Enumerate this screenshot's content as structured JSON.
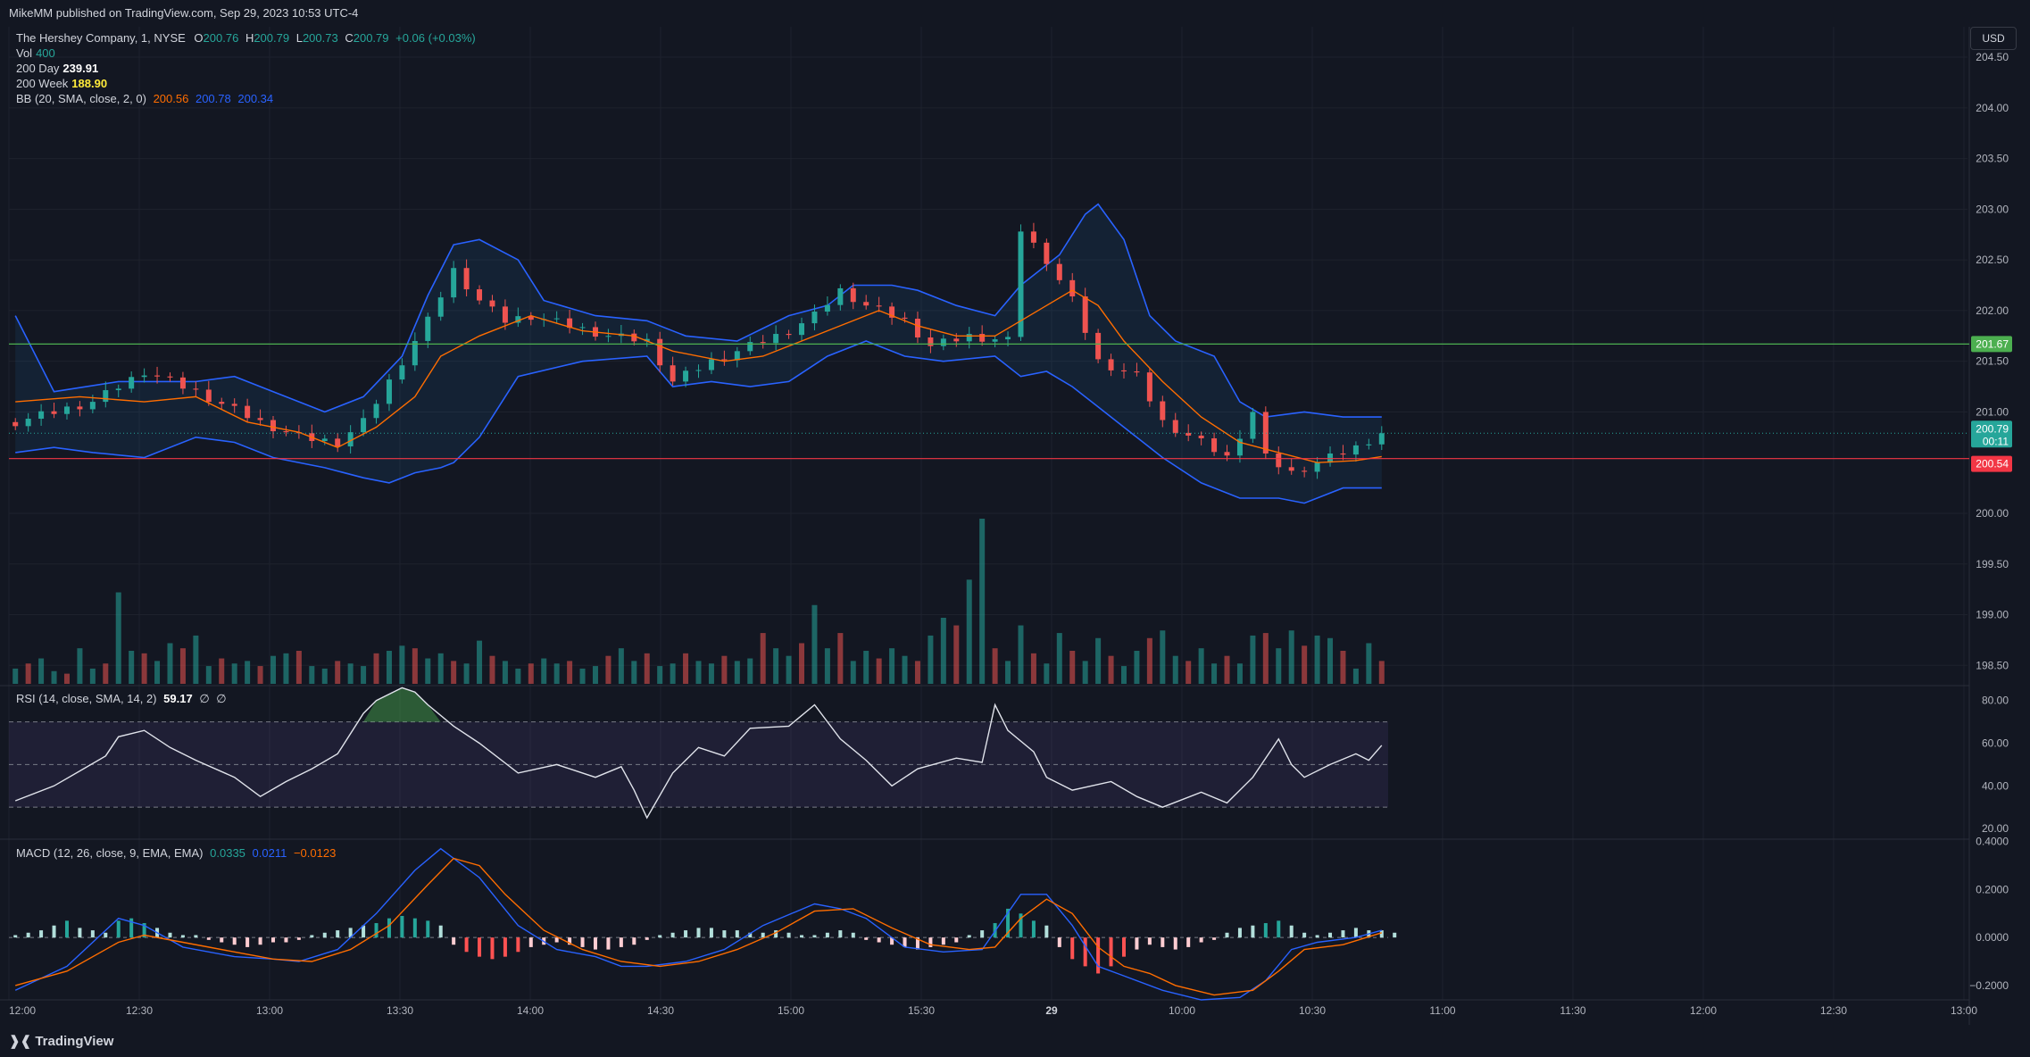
{
  "header": {
    "published": "MikeMM published on TradingView.com, Sep 29, 2023 10:53 UTC-4"
  },
  "legend": {
    "symbol": "The Hershey Company, 1, NYSE",
    "o_label": "O",
    "o_value": "200.76",
    "h_label": "H",
    "h_value": "200.79",
    "l_label": "L",
    "l_value": "200.73",
    "c_label": "C",
    "c_value": "200.79",
    "change": "+0.06 (+0.03%)",
    "vol_label": "Vol",
    "vol_value": "400",
    "ma200d_label": "200 Day",
    "ma200d_value": "239.91",
    "ma200w_label": "200 Week",
    "ma200w_value": "188.90",
    "bb_label": "BB (20, SMA, close, 2, 0)",
    "bb_basis": "200.56",
    "bb_upper": "200.78",
    "bb_lower": "200.34",
    "rsi_label": "RSI (14, close, SMA, 14, 2)",
    "rsi_value": "59.17",
    "rsi_extra1": "∅",
    "rsi_extra2": "∅",
    "macd_label": "MACD (12, 26, close, 9, EMA, EMA)",
    "macd_value": "0.0335",
    "macd_signal": "0.0211",
    "macd_hist": "−0.0123"
  },
  "currency": "USD",
  "footer": {
    "logo": "TradingView",
    "logo_icon": "tradingview-logo-icon"
  },
  "colors": {
    "up": "#26a69a",
    "down": "#ef5350",
    "bb": "#2962ff",
    "basis": "#ff6d00",
    "green_line": "#4caf50",
    "red_line": "#f23645"
  },
  "chart_data": {
    "type": "candlestick",
    "symbol": "HSY",
    "price_axis": {
      "ticks": [
        "204.50",
        "204.00",
        "203.50",
        "203.00",
        "202.50",
        "202.00",
        "201.50",
        "201.00",
        "200.00",
        "199.50",
        "199.00",
        "198.50"
      ],
      "range": [
        198.3,
        204.8
      ]
    },
    "price_labels": {
      "green_line": "201.67",
      "current_price": "200.79",
      "countdown": "00:11",
      "red_line": "200.54"
    },
    "horizontal_lines": {
      "green": 201.67,
      "red": 200.54
    },
    "time_axis": [
      "12:00",
      "12:30",
      "13:00",
      "13:30",
      "14:00",
      "14:30",
      "15:00",
      "15:30",
      "29",
      "10:00",
      "10:30",
      "11:00",
      "11:30",
      "12:00",
      "12:30",
      "13:00"
    ],
    "close_path": [
      [
        0,
        200.9
      ],
      [
        6,
        201.1
      ],
      [
        10,
        201.4
      ],
      [
        14,
        201.2
      ],
      [
        19,
        200.9
      ],
      [
        22,
        200.75
      ],
      [
        25,
        200.7
      ],
      [
        27,
        200.9
      ],
      [
        30,
        201.5
      ],
      [
        32,
        201.9
      ],
      [
        34,
        202.4
      ],
      [
        36,
        202.1
      ],
      [
        38,
        201.9
      ],
      [
        40,
        201.95
      ],
      [
        43,
        201.85
      ],
      [
        46,
        201.75
      ],
      [
        49,
        201.7
      ],
      [
        51,
        201.3
      ],
      [
        54,
        201.5
      ],
      [
        57,
        201.65
      ],
      [
        60,
        201.8
      ],
      [
        62,
        201.95
      ],
      [
        64,
        202.2
      ],
      [
        66,
        202.05
      ],
      [
        69,
        201.9
      ],
      [
        71,
        201.65
      ],
      [
        74,
        201.75
      ],
      [
        77,
        201.7
      ],
      [
        78,
        202.8
      ],
      [
        80,
        202.5
      ],
      [
        82,
        202.1
      ],
      [
        84,
        201.5
      ],
      [
        87,
        201.35
      ],
      [
        89,
        200.9
      ],
      [
        92,
        200.7
      ],
      [
        94,
        200.55
      ],
      [
        96,
        201.0
      ],
      [
        97,
        200.55
      ],
      [
        99,
        200.4
      ],
      [
        102,
        200.55
      ],
      [
        104,
        200.65
      ],
      [
        106,
        200.79
      ]
    ],
    "bb_upper_path": [
      [
        0,
        201.95
      ],
      [
        3,
        201.2
      ],
      [
        8,
        201.3
      ],
      [
        14,
        201.3
      ],
      [
        17,
        201.35
      ],
      [
        20,
        201.2
      ],
      [
        24,
        201.0
      ],
      [
        27,
        201.15
      ],
      [
        30,
        201.55
      ],
      [
        32,
        202.15
      ],
      [
        34,
        202.65
      ],
      [
        36,
        202.7
      ],
      [
        39,
        202.5
      ],
      [
        41,
        202.1
      ],
      [
        45,
        201.95
      ],
      [
        49,
        201.9
      ],
      [
        52,
        201.75
      ],
      [
        56,
        201.7
      ],
      [
        60,
        201.95
      ],
      [
        63,
        202.05
      ],
      [
        65,
        202.25
      ],
      [
        68,
        202.25
      ],
      [
        70,
        202.2
      ],
      [
        73,
        202.05
      ],
      [
        76,
        201.95
      ],
      [
        78,
        202.25
      ],
      [
        81,
        202.55
      ],
      [
        83,
        202.95
      ],
      [
        84,
        203.05
      ],
      [
        86,
        202.7
      ],
      [
        88,
        201.95
      ],
      [
        90,
        201.7
      ],
      [
        93,
        201.55
      ],
      [
        95,
        201.1
      ],
      [
        97,
        200.95
      ],
      [
        100,
        201.0
      ],
      [
        103,
        200.95
      ],
      [
        106,
        200.95
      ]
    ],
    "bb_lower_path": [
      [
        0,
        200.6
      ],
      [
        3,
        200.65
      ],
      [
        6,
        200.6
      ],
      [
        10,
        200.55
      ],
      [
        14,
        200.75
      ],
      [
        17,
        200.7
      ],
      [
        20,
        200.55
      ],
      [
        24,
        200.45
      ],
      [
        27,
        200.35
      ],
      [
        29,
        200.3
      ],
      [
        31,
        200.4
      ],
      [
        33,
        200.45
      ],
      [
        34,
        200.5
      ],
      [
        36,
        200.75
      ],
      [
        39,
        201.35
      ],
      [
        44,
        201.5
      ],
      [
        49,
        201.55
      ],
      [
        51,
        201.25
      ],
      [
        54,
        201.3
      ],
      [
        57,
        201.25
      ],
      [
        60,
        201.3
      ],
      [
        63,
        201.55
      ],
      [
        66,
        201.7
      ],
      [
        69,
        201.55
      ],
      [
        72,
        201.5
      ],
      [
        76,
        201.55
      ],
      [
        78,
        201.35
      ],
      [
        80,
        201.4
      ],
      [
        82,
        201.25
      ],
      [
        84,
        201.05
      ],
      [
        86,
        200.85
      ],
      [
        89,
        200.55
      ],
      [
        92,
        200.3
      ],
      [
        95,
        200.15
      ],
      [
        98,
        200.15
      ],
      [
        100,
        200.1
      ],
      [
        103,
        200.25
      ],
      [
        106,
        200.25
      ]
    ],
    "bb_basis_path": [
      [
        0,
        201.1
      ],
      [
        5,
        201.15
      ],
      [
        10,
        201.1
      ],
      [
        14,
        201.15
      ],
      [
        18,
        200.9
      ],
      [
        22,
        200.8
      ],
      [
        25,
        200.65
      ],
      [
        28,
        200.85
      ],
      [
        31,
        201.15
      ],
      [
        33,
        201.55
      ],
      [
        36,
        201.75
      ],
      [
        40,
        201.95
      ],
      [
        44,
        201.8
      ],
      [
        48,
        201.75
      ],
      [
        51,
        201.6
      ],
      [
        55,
        201.5
      ],
      [
        58,
        201.55
      ],
      [
        61,
        201.7
      ],
      [
        64,
        201.85
      ],
      [
        67,
        202.0
      ],
      [
        70,
        201.85
      ],
      [
        73,
        201.75
      ],
      [
        76,
        201.75
      ],
      [
        78,
        201.9
      ],
      [
        80,
        202.05
      ],
      [
        82,
        202.2
      ],
      [
        84,
        202.05
      ],
      [
        86,
        201.7
      ],
      [
        89,
        201.3
      ],
      [
        92,
        200.95
      ],
      [
        95,
        200.7
      ],
      [
        98,
        200.6
      ],
      [
        101,
        200.5
      ],
      [
        104,
        200.52
      ],
      [
        106,
        200.56
      ]
    ],
    "volume": [
      6,
      8,
      10,
      5,
      4,
      14,
      6,
      8,
      36,
      13,
      12,
      9,
      16,
      14,
      19,
      7,
      10,
      8,
      9,
      7,
      11,
      12,
      13,
      7,
      6,
      9,
      8,
      7,
      12,
      13,
      15,
      14,
      10,
      12,
      9,
      8,
      17,
      11,
      9,
      6,
      8,
      10,
      8,
      9,
      6,
      7,
      11,
      14,
      9,
      12,
      7,
      8,
      12,
      9,
      8,
      11,
      9,
      10,
      20,
      14,
      11,
      16,
      31,
      14,
      20,
      9,
      13,
      10,
      14,
      11,
      9,
      19,
      26,
      23,
      41,
      65,
      14,
      9,
      23,
      12,
      8,
      20,
      13,
      9,
      18,
      11,
      7,
      13,
      18,
      21,
      11,
      9,
      14,
      8,
      11,
      8,
      19,
      20,
      14,
      21,
      15,
      19,
      18,
      13,
      6,
      16,
      9
    ],
    "rsi": {
      "ticks": [
        "80.00",
        "60.00",
        "40.00",
        "20.00"
      ],
      "bands": [
        70,
        50,
        30
      ],
      "range": [
        15,
        87
      ],
      "value": 59.17,
      "path": [
        [
          0,
          33
        ],
        [
          3,
          40
        ],
        [
          5,
          47
        ],
        [
          7,
          54
        ],
        [
          8,
          63
        ],
        [
          10,
          66
        ],
        [
          12,
          58
        ],
        [
          14,
          52
        ],
        [
          17,
          44
        ],
        [
          19,
          35
        ],
        [
          21,
          42
        ],
        [
          23,
          48
        ],
        [
          25,
          55
        ],
        [
          27,
          74
        ],
        [
          28,
          80
        ],
        [
          30,
          86
        ],
        [
          31,
          84
        ],
        [
          32,
          78
        ],
        [
          34,
          68
        ],
        [
          36,
          60
        ],
        [
          39,
          46
        ],
        [
          42,
          50
        ],
        [
          45,
          44
        ],
        [
          47,
          49
        ],
        [
          48,
          38
        ],
        [
          49,
          25
        ],
        [
          51,
          46
        ],
        [
          53,
          58
        ],
        [
          55,
          54
        ],
        [
          57,
          67
        ],
        [
          60,
          68
        ],
        [
          62,
          78
        ],
        [
          64,
          62
        ],
        [
          66,
          52
        ],
        [
          68,
          40
        ],
        [
          70,
          48
        ],
        [
          73,
          53
        ],
        [
          75,
          51
        ],
        [
          76,
          78
        ],
        [
          77,
          66
        ],
        [
          79,
          56
        ],
        [
          80,
          44
        ],
        [
          82,
          38
        ],
        [
          85,
          42
        ],
        [
          87,
          35
        ],
        [
          89,
          30
        ],
        [
          92,
          37
        ],
        [
          94,
          32
        ],
        [
          96,
          44
        ],
        [
          98,
          62
        ],
        [
          99,
          50
        ],
        [
          100,
          44
        ],
        [
          102,
          50
        ],
        [
          104,
          55
        ],
        [
          105,
          52
        ],
        [
          106,
          59
        ]
      ]
    },
    "macd": {
      "ticks": [
        "0.4000",
        "0.2000",
        "0.0000",
        "−0.2000"
      ],
      "range": [
        -0.26,
        0.41
      ],
      "macd_path": [
        [
          0,
          -0.22
        ],
        [
          4,
          -0.12
        ],
        [
          8,
          0.08
        ],
        [
          10,
          0.05
        ],
        [
          13,
          -0.04
        ],
        [
          17,
          -0.08
        ],
        [
          20,
          -0.09
        ],
        [
          22,
          -0.1
        ],
        [
          25,
          -0.05
        ],
        [
          28,
          0.1
        ],
        [
          31,
          0.28
        ],
        [
          33,
          0.37
        ],
        [
          36,
          0.25
        ],
        [
          39,
          0.05
        ],
        [
          42,
          -0.05
        ],
        [
          45,
          -0.08
        ],
        [
          47,
          -0.12
        ],
        [
          49,
          -0.12
        ],
        [
          52,
          -0.1
        ],
        [
          55,
          -0.05
        ],
        [
          58,
          0.05
        ],
        [
          62,
          0.14
        ],
        [
          64,
          0.12
        ],
        [
          66,
          0.08
        ],
        [
          69,
          -0.04
        ],
        [
          72,
          -0.06
        ],
        [
          75,
          -0.05
        ],
        [
          78,
          0.18
        ],
        [
          80,
          0.18
        ],
        [
          82,
          0.05
        ],
        [
          84,
          -0.12
        ],
        [
          86,
          -0.16
        ],
        [
          89,
          -0.22
        ],
        [
          92,
          -0.26
        ],
        [
          95,
          -0.25
        ],
        [
          97,
          -0.18
        ],
        [
          99,
          -0.05
        ],
        [
          101,
          -0.02
        ],
        [
          104,
          0.0
        ],
        [
          106,
          0.03
        ]
      ],
      "signal_path": [
        [
          0,
          -0.2
        ],
        [
          4,
          -0.14
        ],
        [
          8,
          -0.02
        ],
        [
          10,
          0.01
        ],
        [
          13,
          -0.02
        ],
        [
          17,
          -0.06
        ],
        [
          20,
          -0.09
        ],
        [
          23,
          -0.1
        ],
        [
          26,
          -0.05
        ],
        [
          29,
          0.05
        ],
        [
          32,
          0.22
        ],
        [
          34,
          0.33
        ],
        [
          36,
          0.3
        ],
        [
          38,
          0.18
        ],
        [
          41,
          0.03
        ],
        [
          44,
          -0.05
        ],
        [
          47,
          -0.1
        ],
        [
          50,
          -0.12
        ],
        [
          53,
          -0.1
        ],
        [
          56,
          -0.05
        ],
        [
          59,
          0.02
        ],
        [
          62,
          0.11
        ],
        [
          65,
          0.12
        ],
        [
          68,
          0.04
        ],
        [
          71,
          -0.03
        ],
        [
          74,
          -0.05
        ],
        [
          76,
          -0.04
        ],
        [
          78,
          0.08
        ],
        [
          80,
          0.16
        ],
        [
          82,
          0.1
        ],
        [
          84,
          -0.04
        ],
        [
          86,
          -0.12
        ],
        [
          88,
          -0.15
        ],
        [
          90,
          -0.2
        ],
        [
          93,
          -0.24
        ],
        [
          96,
          -0.22
        ],
        [
          98,
          -0.14
        ],
        [
          100,
          -0.05
        ],
        [
          103,
          -0.03
        ],
        [
          106,
          0.02
        ]
      ],
      "histogram": [
        0.01,
        0.02,
        0.03,
        0.05,
        0.07,
        0.04,
        0.03,
        0.02,
        0.07,
        0.08,
        0.06,
        0.04,
        0.02,
        0.01,
        0.01,
        -0.01,
        -0.02,
        -0.03,
        -0.04,
        -0.03,
        -0.02,
        -0.02,
        -0.01,
        0.01,
        0.02,
        0.03,
        0.04,
        0.05,
        0.06,
        0.08,
        0.09,
        0.08,
        0.07,
        0.05,
        -0.03,
        -0.06,
        -0.08,
        -0.09,
        -0.08,
        -0.06,
        -0.04,
        -0.03,
        -0.02,
        -0.03,
        -0.04,
        -0.05,
        -0.05,
        -0.04,
        -0.03,
        -0.01,
        0.01,
        0.02,
        0.03,
        0.04,
        0.04,
        0.03,
        0.03,
        0.02,
        0.02,
        0.03,
        0.02,
        0.01,
        0.01,
        0.02,
        0.03,
        0.02,
        -0.01,
        -0.02,
        -0.03,
        -0.04,
        -0.05,
        -0.04,
        -0.03,
        -0.02,
        0.01,
        0.03,
        0.06,
        0.12,
        0.1,
        0.07,
        0.05,
        -0.04,
        -0.09,
        -0.12,
        -0.15,
        -0.12,
        -0.08,
        -0.05,
        -0.03,
        -0.04,
        -0.05,
        -0.04,
        -0.02,
        -0.01,
        0.02,
        0.04,
        0.05,
        0.06,
        0.07,
        0.05,
        0.02,
        0.01,
        0.02,
        0.03,
        0.04,
        0.03,
        0.03,
        0.02
      ]
    }
  }
}
